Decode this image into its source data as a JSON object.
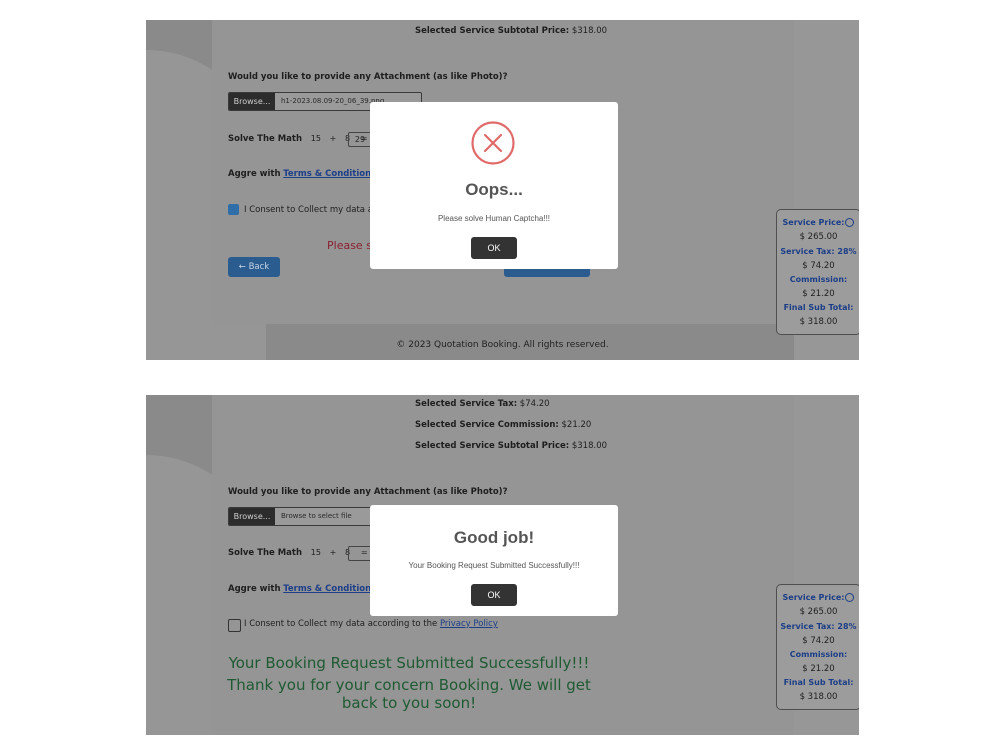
{
  "screen1": {
    "subtotal_label": "Selected Service Subtotal Price:",
    "subtotal_value": "$318.00",
    "attachment_question": "Would you like to provide any Attachment (as like Photo)?",
    "browse_label": "Browse...",
    "file_name": "h1-2023.08.09-20_06_39.png",
    "math_label": "Solve The Math",
    "math_a": "15",
    "math_plus": "+",
    "math_b": "8",
    "math_eq": "=",
    "math_answer": "29",
    "agree_prefix": "Aggre with",
    "terms_link": "Terms & Conditions",
    "consent_text": "I Consent to Collect my data a",
    "consent_checked": true,
    "error_text": "Please s",
    "back_label": "← Back",
    "footer": "© 2023 Quotation Booking. All rights reserved.",
    "panel": {
      "service_price_label": "Service Price:",
      "service_price": "$ 265.00",
      "service_tax_label": "Service Tax: 28%",
      "service_tax": "$ 74.20",
      "commission_label": "Commission:",
      "commission": "$ 21.20",
      "final_label": "Final Sub Total:",
      "final": "$ 318.00"
    },
    "modal": {
      "icon": "error-x-icon",
      "title": "Oops...",
      "message": "Please solve Human Captcha!!!",
      "ok": "OK"
    }
  },
  "screen2": {
    "tax_label": "Selected Service Tax:",
    "tax_value": "$74.20",
    "commission_label": "Selected Service Commission:",
    "commission_value": "$21.20",
    "subtotal_label": "Selected Service Subtotal Price:",
    "subtotal_value": "$318.00",
    "attachment_question": "Would you like to provide any Attachment (as like Photo)?",
    "browse_label": "Browse...",
    "file_placeholder": "Browse to select file",
    "math_label": "Solve The Math",
    "math_a": "15",
    "math_plus": "+",
    "math_b": "8",
    "math_eq": "=",
    "agree_prefix": "Aggre with",
    "terms_link": "Terms & Conditions",
    "consent_text": "I Consent to Collect my data according to the",
    "privacy_link": "Privacy Policy",
    "consent_checked": false,
    "success_line1": "Your Booking Request Submitted Successfully!!!",
    "success_line2": "Thank you for your concern Booking. We will get",
    "success_line3": "back to you soon!",
    "panel": {
      "service_price_label": "Service Price:",
      "service_price": "$ 265.00",
      "service_tax_label": "Service Tax: 28%",
      "service_tax": "$ 74.20",
      "commission_label": "Commission:",
      "commission": "$ 21.20",
      "final_label": "Final Sub Total:",
      "final": "$ 318.00"
    },
    "modal": {
      "title": "Good job!",
      "message": "Your Booking Request Submitted Successfully!!!",
      "ok": "OK"
    }
  },
  "colors": {
    "overlay_gray": "#8a8a8a",
    "modal_bg": "#ffffff",
    "error_red": "#e06a6a",
    "primary_blue": "#2a5c8f",
    "ok_button": "#333333",
    "success_green": "#1e5a32",
    "panel_label_blue": "#1c3e88"
  }
}
